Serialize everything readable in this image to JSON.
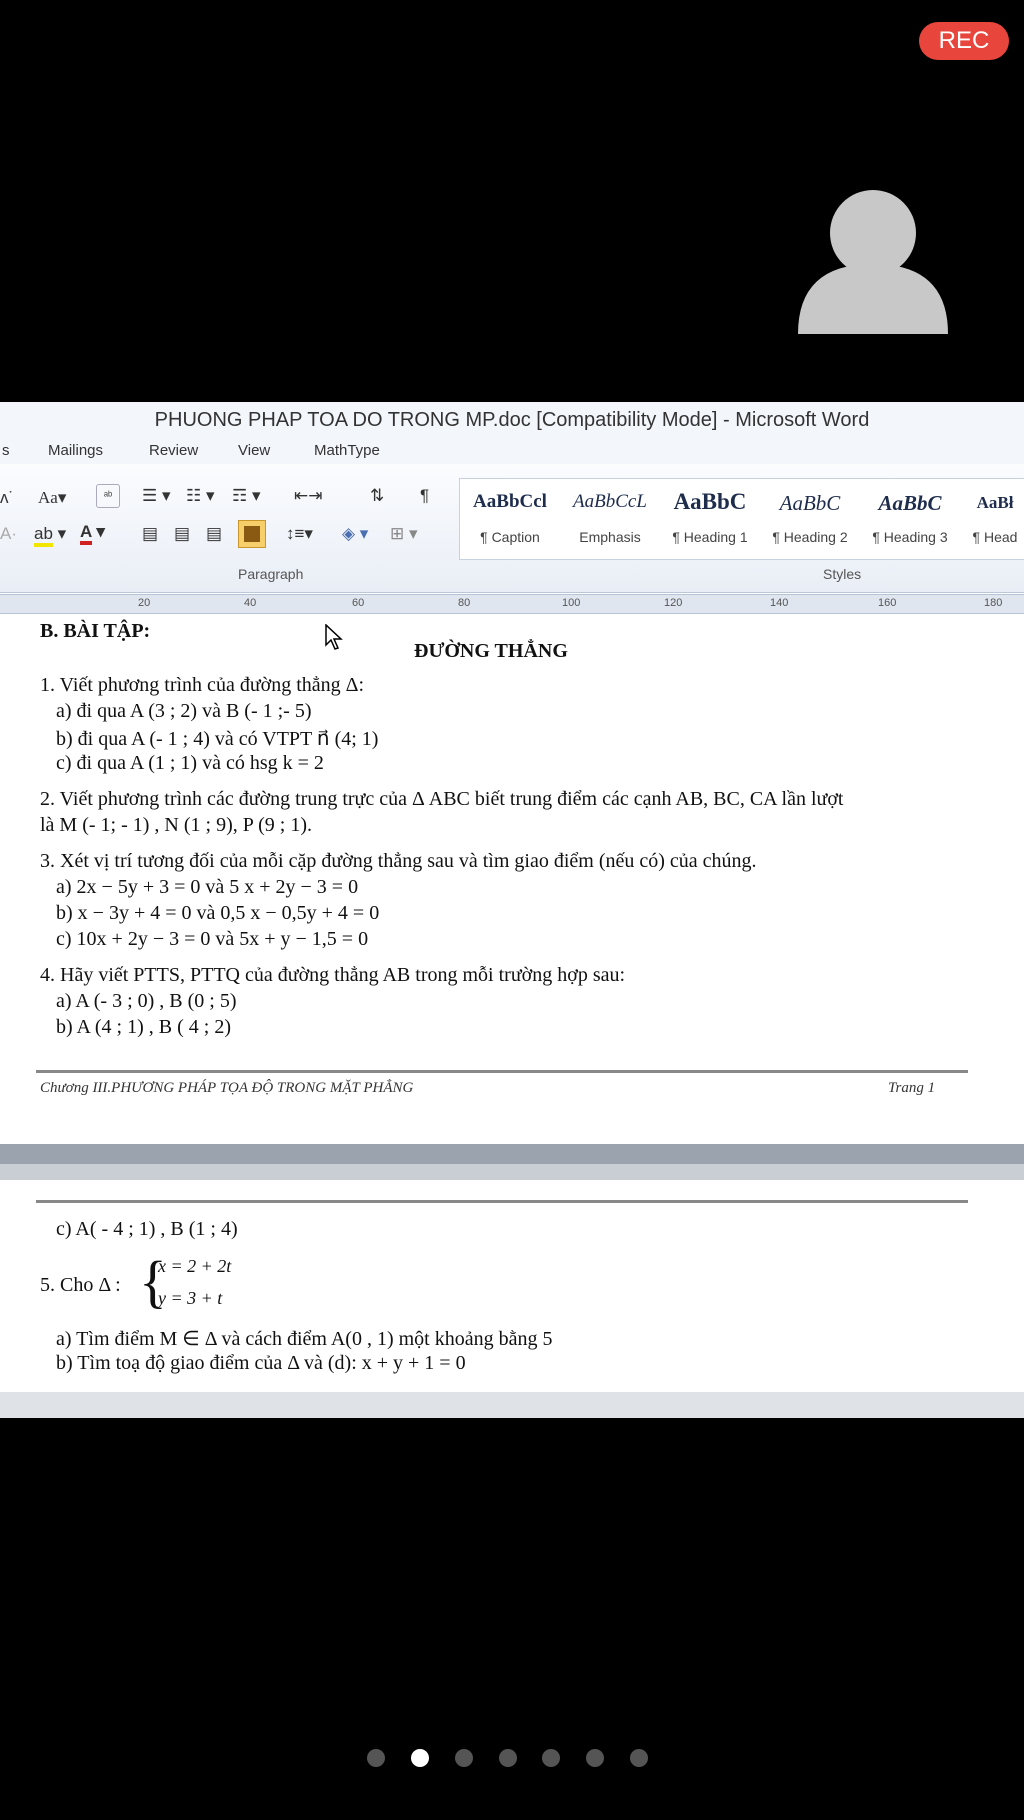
{
  "overlay": {
    "rec_label": "REC"
  },
  "window": {
    "title": "PHUONG PHAP TOA DO TRONG MP.doc [Compatibility Mode] - Microsoft Word"
  },
  "tabs": [
    "s",
    "Mailings",
    "Review",
    "View",
    "MathType"
  ],
  "ribbon": {
    "font_size_button": "Aa",
    "paragraph_label": "Paragraph",
    "styles_label": "Styles",
    "styles": [
      {
        "preview": "AaBbCcl",
        "name": "¶ Caption"
      },
      {
        "preview": "AaBbCcL",
        "name": "Emphasis"
      },
      {
        "preview": "AaBbC",
        "name": "¶ Heading 1"
      },
      {
        "preview": "AaBbC",
        "name": "¶ Heading 2"
      },
      {
        "preview": "AaBbC",
        "name": "¶ Heading 3"
      },
      {
        "preview": "AaBł",
        "name": "¶ Head"
      }
    ]
  },
  "ruler": [
    "20",
    "40",
    "60",
    "80",
    "100",
    "120",
    "140",
    "160",
    "180"
  ],
  "page1": {
    "section": "B. BÀI TẬP:",
    "heading": "ĐƯỜNG THẲNG",
    "q1": "1. Viết phương trình của đường thẳng Δ:",
    "q1a": "a) đi qua A (3 ; 2) và B (- 1 ;- 5)",
    "q1b": "b) đi qua A (- 1 ; 4) và có  VTPT n⃗ (4; 1)",
    "q1c": "c) đi qua A (1 ; 1) và có hsg k = 2",
    "q2": "2. Viết phương trình các đường trung trực của Δ ABC biết trung điểm các cạnh AB, BC, CA lần lượt",
    "q2b": "là M (- 1; - 1) ,  N (1 ; 9), P (9 ; 1).",
    "q3": "3. Xét vị trí tương đối của mỗi cặp đường thẳng sau và tìm giao điểm (nếu có) của chúng.",
    "q3a": "a) 2x − 5y + 3 = 0  và   5 x + 2y − 3 = 0",
    "q3b": "b) x − 3y + 4 = 0    và   0,5 x − 0,5y + 4 = 0",
    "q3c": "c) 10x + 2y − 3 = 0 và  5x + y − 1,5 = 0",
    "q4": "4. Hãy viết PTTS, PTTQ của đường thẳng AB trong mỗi trường hợp sau:",
    "q4a": "a) A (- 3 ; 0) , B (0 ; 5)",
    "q4b": "b) A (4 ; 1)    , B ( 4 ; 2)",
    "footer_left": "Chương III.PHƯƠNG PHÁP TỌA ĐỘ TRONG MẶT PHẲNG",
    "footer_right": "Trang 1"
  },
  "page2": {
    "q4c": "c) A( - 4 ; 1) ,  B (1 ; 4)",
    "q5_prefix": "5. Cho Δ :",
    "eq1": "x = 2 + 2t",
    "eq2": "y = 3 + t",
    "q5a": "a) Tìm điểm M ∈ Δ và cách điểm A(0 , 1) một khoảng bằng 5",
    "q5b": "b) Tìm toạ độ giao điểm của Δ và (d): x + y + 1 = 0"
  }
}
